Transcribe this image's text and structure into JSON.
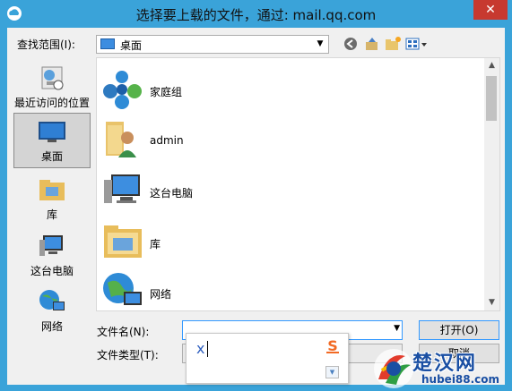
{
  "window": {
    "title": "选择要上载的文件，通过: mail.qq.com",
    "close_glyph": "✕",
    "app_icon": "qq-mail-cloud-icon"
  },
  "lookin": {
    "label": "查找范围(I):",
    "value": "桌面",
    "icon": "desktop-icon"
  },
  "toolbar": {
    "back_icon": "back-arrow-icon",
    "up_icon": "up-folder-icon",
    "new_folder_icon": "new-folder-icon",
    "view_icon": "view-menu-icon"
  },
  "places": [
    {
      "label": "最近访问的位置",
      "icon": "recent-places-icon",
      "selected": false
    },
    {
      "label": "桌面",
      "icon": "desktop-icon",
      "selected": true
    },
    {
      "label": "库",
      "icon": "library-icon",
      "selected": false
    },
    {
      "label": "这台电脑",
      "icon": "computer-icon",
      "selected": false
    },
    {
      "label": "网络",
      "icon": "network-icon",
      "selected": false
    }
  ],
  "files": [
    {
      "label": "家庭组",
      "icon": "homegroup-icon"
    },
    {
      "label": "admin",
      "icon": "user-folder-icon"
    },
    {
      "label": "这台电脑",
      "icon": "computer-icon"
    },
    {
      "label": "库",
      "icon": "library-icon"
    },
    {
      "label": "网络",
      "icon": "network-icon"
    }
  ],
  "form": {
    "filename_label": "文件名(N):",
    "filename_value": "",
    "filetype_label": "文件类型(T):",
    "filetype_value": "",
    "open_label": "打开(O)",
    "cancel_label": "取消"
  },
  "ime": {
    "typed": "x",
    "logo": "sogou-s-icon"
  },
  "watermark": {
    "text": "楚汉网",
    "url": "hubei88.com"
  }
}
